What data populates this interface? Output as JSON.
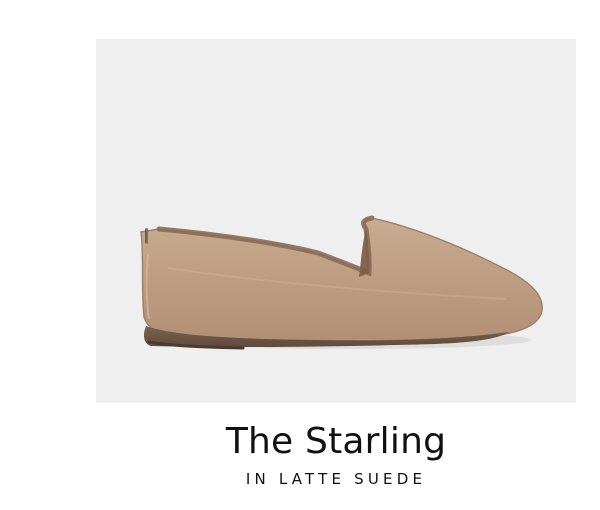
{
  "product": {
    "title": "The Starling",
    "subtitle": "IN LATTE SUEDE",
    "image_icon": "shoe-icon",
    "shoe_color": "#b89a7e",
    "panel_color": "#efefef"
  }
}
